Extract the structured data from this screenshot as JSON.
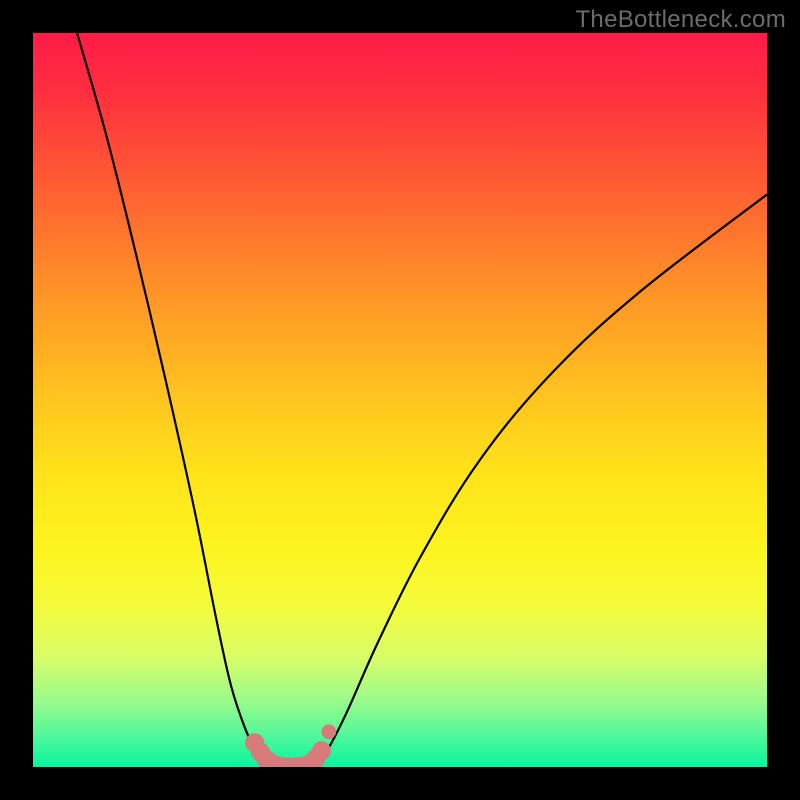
{
  "watermark": "TheBottleneck.com",
  "colors": {
    "frame": "#000000",
    "watermark": "#6c6c6c",
    "curve": "#000000",
    "marker_fill": "#d77a7a",
    "gradient_top": "#ff1b48",
    "gradient_bottom": "#07f59d"
  },
  "chart_data": {
    "type": "line",
    "title": "",
    "xlabel": "",
    "ylabel": "",
    "xlim": [
      0,
      100
    ],
    "ylim": [
      0,
      100
    ],
    "series": [
      {
        "name": "left-curve",
        "x": [
          6,
          10,
          14,
          18,
          22,
          25,
          27,
          29,
          30.5,
          31.5,
          32.5,
          33.5
        ],
        "values": [
          100,
          86,
          70,
          53,
          35,
          20,
          11,
          5,
          2,
          1,
          0.5,
          0
        ]
      },
      {
        "name": "right-curve",
        "x": [
          38,
          39,
          40.5,
          43,
          47,
          53,
          61,
          71,
          83,
          100
        ],
        "values": [
          0,
          1,
          3,
          8,
          17,
          29,
          42,
          54,
          65,
          78
        ]
      }
    ],
    "markers": [
      {
        "x": 30.2,
        "y": 3.3,
        "r": 1.3
      },
      {
        "x": 31.0,
        "y": 2.0,
        "r": 1.3
      },
      {
        "x": 31.8,
        "y": 1.0,
        "r": 1.3
      },
      {
        "x": 32.7,
        "y": 0.4,
        "r": 1.3
      },
      {
        "x": 33.7,
        "y": 0.1,
        "r": 1.3
      },
      {
        "x": 34.7,
        "y": 0.0,
        "r": 1.3
      },
      {
        "x": 35.7,
        "y": 0.0,
        "r": 1.3
      },
      {
        "x": 36.7,
        "y": 0.1,
        "r": 1.3
      },
      {
        "x": 37.7,
        "y": 0.4,
        "r": 1.3
      },
      {
        "x": 38.5,
        "y": 1.1,
        "r": 1.3
      },
      {
        "x": 39.3,
        "y": 2.2,
        "r": 1.3
      },
      {
        "x": 40.3,
        "y": 4.8,
        "r": 1.0
      }
    ]
  }
}
